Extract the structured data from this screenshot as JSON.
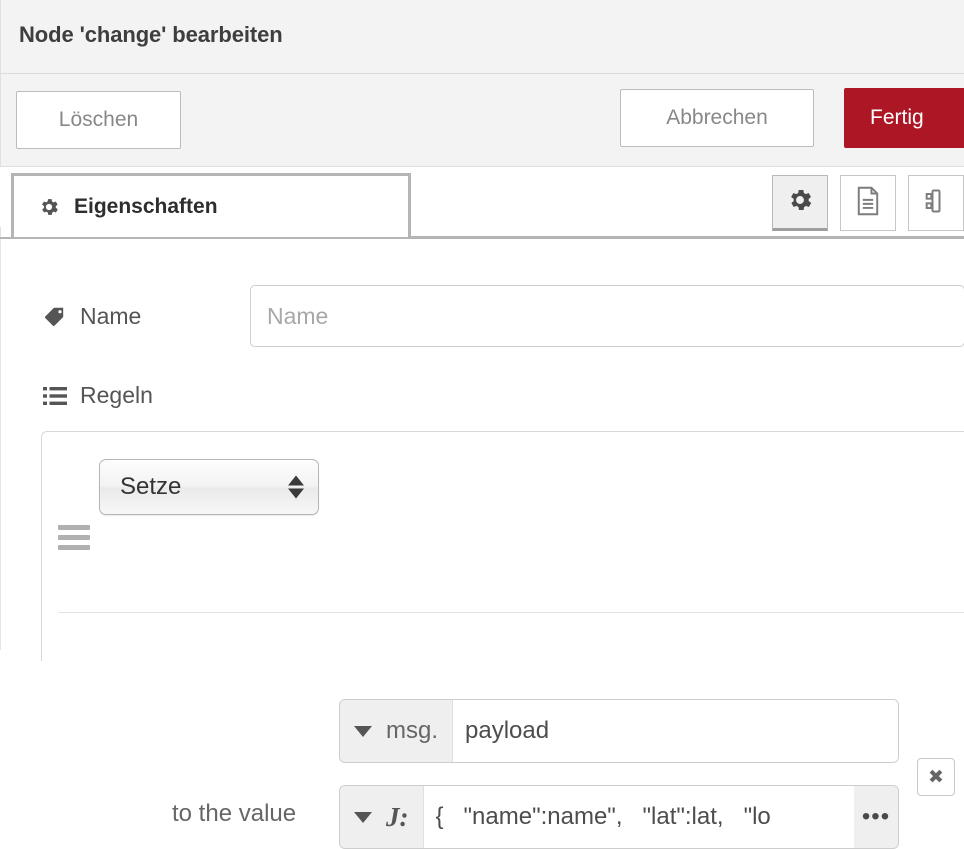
{
  "dialog": {
    "title": "Node 'change' bearbeiten"
  },
  "toolbar": {
    "delete_label": "Löschen",
    "cancel_label": "Abbrechen",
    "done_label": "Fertig",
    "done_color": "#ad1625"
  },
  "tabs": {
    "active": {
      "label": "Eigenschaften",
      "icon": "gear-icon"
    },
    "icon_buttons": [
      {
        "name": "gear-icon",
        "active": true
      },
      {
        "name": "description-document-icon",
        "active": false
      },
      {
        "name": "appearance-icon",
        "active": false
      }
    ]
  },
  "form": {
    "name": {
      "label": "Name",
      "icon": "tag-icon",
      "value": "",
      "placeholder": "Name"
    },
    "rules": {
      "label": "Regeln",
      "icon": "list-icon"
    }
  },
  "rule": {
    "action": "Setze",
    "property": {
      "type_label": "msg.",
      "value": "payload"
    },
    "value": {
      "type_label": "J:",
      "type_name": "jsonata",
      "value": "{   \"name\":name\",   \"lat\":lat,   \"lo",
      "expand_label": "•••"
    },
    "to_the_value_label": "to the value",
    "remove_label": "✖"
  }
}
